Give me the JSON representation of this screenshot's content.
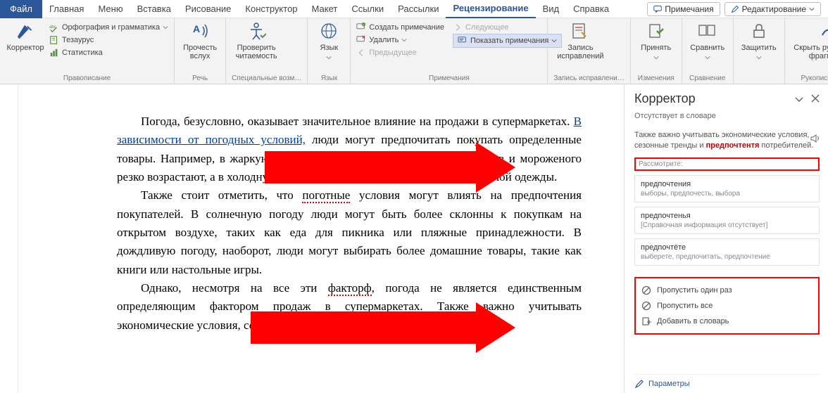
{
  "tabs": {
    "file": "Файл",
    "items": [
      "Главная",
      "Меню",
      "Вставка",
      "Рисование",
      "Конструктор",
      "Макет",
      "Ссылки",
      "Рассылки",
      "Рецензирование",
      "Вид",
      "Справка"
    ],
    "activeIndex": 8,
    "comments_btn": "Примечания",
    "editing_btn": "Редактирование"
  },
  "ribbon": {
    "corrector": {
      "label": "Корректор"
    },
    "spelling": {
      "spellgrammar": "Орфография и грамматика",
      "thesaurus": "Тезаурус",
      "stats": "Статистика",
      "group": "Правописание"
    },
    "speech": {
      "read": "Прочесть\nвслух",
      "group": "Речь"
    },
    "access": {
      "check": "Проверить\nчитаемость",
      "group": "Специальные возм…"
    },
    "lang": {
      "lang": "Язык",
      "group": "Язык"
    },
    "comments": {
      "new": "Создать примечание",
      "delete": "Удалить",
      "prev": "Предыдущее",
      "next": "Следующее",
      "show": "Показать примечания",
      "group": "Примечания"
    },
    "track": {
      "track": "Запись\nисправлений",
      "group": "Запись исправлени…"
    },
    "changes": {
      "accept": "Принять",
      "group": "Изменения"
    },
    "compare": {
      "compare": "Сравнить",
      "group": "Сравнение"
    },
    "protect": {
      "protect": "Защитить",
      "group": ""
    },
    "ink": {
      "hide": "Скрыть рукописные\nфрагменты",
      "group": "Рукописный ввод"
    }
  },
  "document": {
    "p1_a": "Погода, безусловно, оказывает значительное влияние на продажи в супермаркетах. ",
    "p1_link": "В зависимости от погодных условий,",
    "p1_b": " люди могут предпочитать покупать определенные товары. Например, в жаркую погоду продажи прохладительных напитков и мороженого резко возрастают, а в холодную погоду – продажи горячих напитков и теплой одежды.",
    "p2_a": "Также стоит отметить, что ",
    "p2_err": "поготные",
    "p2_b": " условия могут влиять на предпочтения покупателей. В солнечную погоду люди могут быть более склонны к покупкам на открытом воздухе, таких как еда для пикника или пляжные принадлежности. В дождливую погоду, наоборот, люди могут выбирать более домашние товары, такие как книги или настольные игры.",
    "p3_a": "Однако, несмотря на все эти ",
    "p3_err": "факторф",
    "p3_b": ", погода не является единственным определяющим фактором продаж в супермаркетах. Также важно учитывать экономические условия, сезонные тренды и ",
    "p3_err2": "предпочтентя",
    "p3_c": " потребителей."
  },
  "panel": {
    "title": "Корректор",
    "sub": "Отсутствует в словаре",
    "context_a": "Также важно учитывать экономические условия, сезонные тренды и ",
    "context_hl": "предпочтентя",
    "context_b": " потребителей.",
    "consider": "Рассмотрите:",
    "suggestions": [
      {
        "title": "предпочтения",
        "sub": "выборы, предпочесть, выбора"
      },
      {
        "title": "предпочтенья",
        "sub": "[Справочная информация отсутствует]"
      },
      {
        "title": "предпочтёте",
        "sub": "выберете, предпочитать, предпочтение"
      }
    ],
    "ignore_once": "Пропустить один раз",
    "ignore_all": "Пропустить все",
    "add_dict": "Добавить в словарь",
    "footer": "Параметры"
  }
}
